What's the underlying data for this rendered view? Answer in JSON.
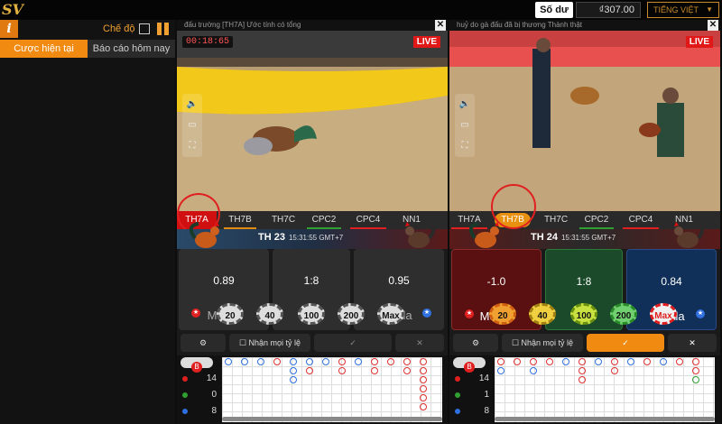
{
  "header": {
    "logo": "SV",
    "balance_label": "Số dư",
    "balance_value": "₫307.00",
    "language": "TIẾNG VIỆT"
  },
  "left_panel": {
    "info_label": "i",
    "mode_label": "Chế độ",
    "tabs": [
      "Cược hiện tại",
      "Báo cáo hôm nay"
    ]
  },
  "tables": [
    {
      "title": "đấu trường [TH7A] Ước tính có tổng",
      "close": "✕",
      "timer": "00:18:65",
      "live": "LIVE",
      "tabs": [
        "TH7A",
        "TH7B",
        "TH7C",
        "CPC2",
        "CPC4",
        "NN1"
      ],
      "selected_tab": "TH7A",
      "header_title": "TH 23",
      "header_time": "15:31:55 GMT+7",
      "bets": [
        {
          "odds": "0.89",
          "label": "Meron"
        },
        {
          "odds": "1:8",
          "label": "BDD"
        },
        {
          "odds": "0.95",
          "label": "Wala"
        }
      ],
      "chips": [
        "20",
        "40",
        "100",
        "200",
        "Max"
      ],
      "accept_odds": "Nhận mọi tỷ lệ",
      "confirm": "✓",
      "cancel": "✕",
      "road_badge": "B",
      "counts": [
        "14",
        "0",
        "8"
      ]
    },
    {
      "title": "huỷ do gà đấu đã bị thương  Thành thật",
      "close": "✕",
      "timer": "",
      "live": "LIVE",
      "tabs": [
        "TH7A",
        "TH7B",
        "TH7C",
        "CPC2",
        "CPC4",
        "NN1"
      ],
      "selected_tab": "TH7B",
      "header_title": "TH 24",
      "header_time": "15:31:55 GMT+7",
      "bets": [
        {
          "odds": "-1.0",
          "label": "Meron"
        },
        {
          "odds": "1:8",
          "label": "BDD"
        },
        {
          "odds": "0.84",
          "label": "Wala"
        }
      ],
      "chips": [
        "20",
        "40",
        "100",
        "200",
        "Max"
      ],
      "accept_odds": "Nhận mọi tỷ lệ",
      "confirm": "✓",
      "cancel": "✕",
      "road_badge": "B",
      "counts": [
        "14",
        "1",
        "8"
      ]
    }
  ],
  "colors": {
    "accent": "#f08a10",
    "meron": "#e02020",
    "wala": "#3070e0",
    "bdd": "#30a030"
  }
}
